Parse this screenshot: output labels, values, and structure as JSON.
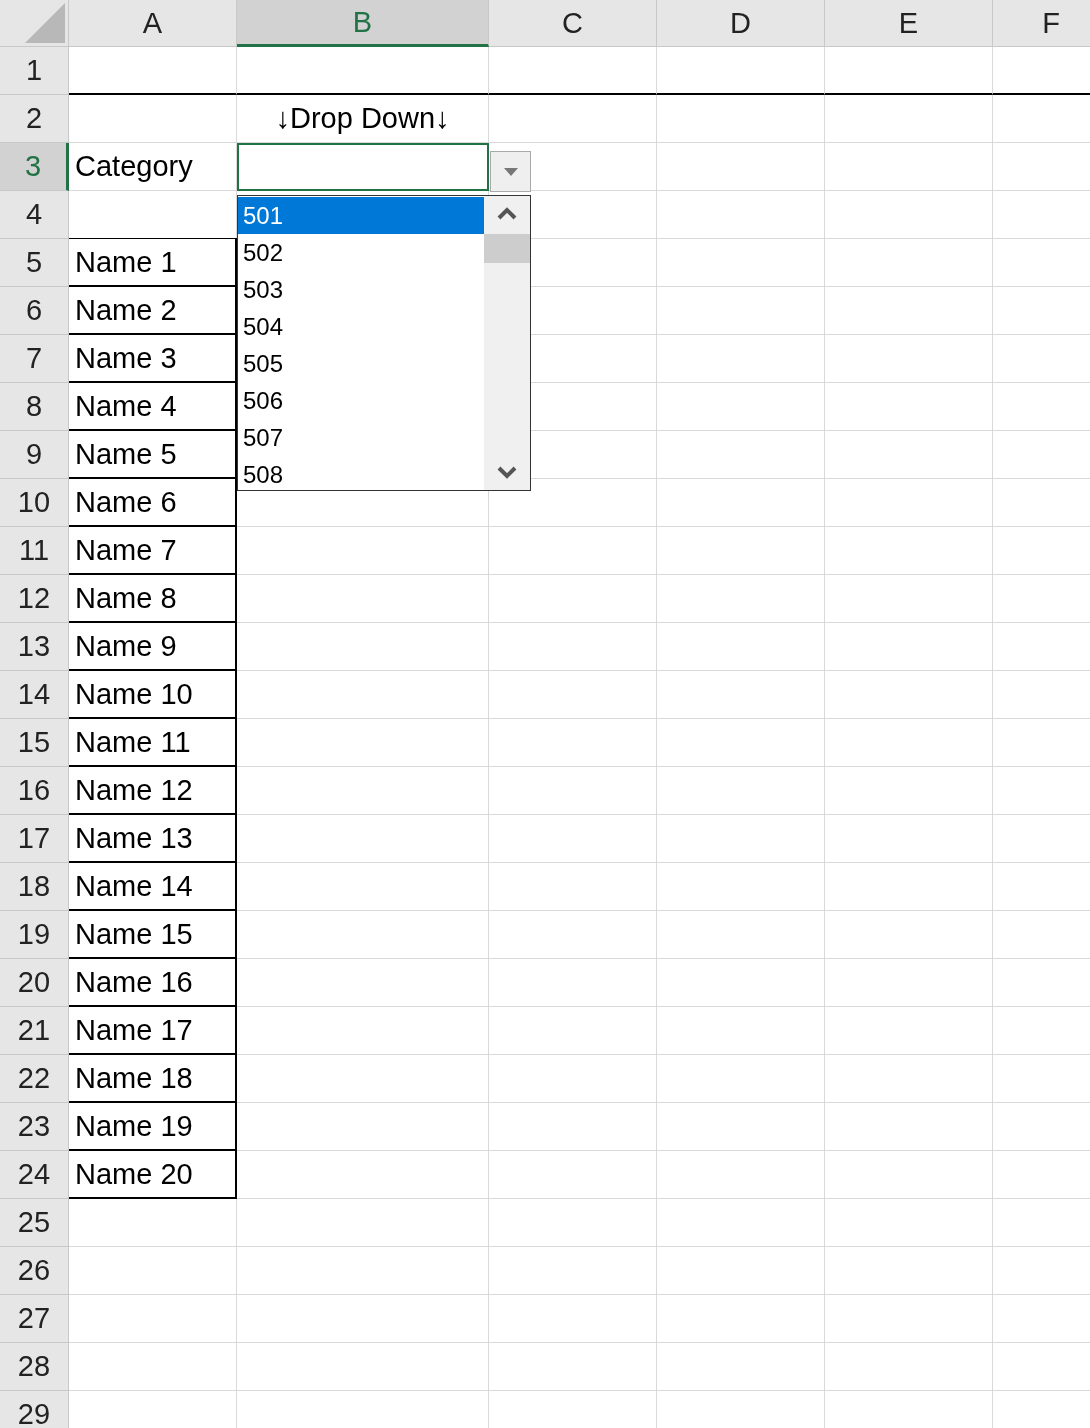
{
  "columns": [
    {
      "label": "A",
      "selected": false
    },
    {
      "label": "B",
      "selected": true
    },
    {
      "label": "C",
      "selected": false
    },
    {
      "label": "D",
      "selected": false
    },
    {
      "label": "E",
      "selected": false
    },
    {
      "label": "F",
      "selected": false
    }
  ],
  "rows": [
    {
      "header": "1",
      "selected": false,
      "rule_below": true
    },
    {
      "header": "2",
      "selected": false,
      "b": "↓Drop Down↓"
    },
    {
      "header": "3",
      "selected": true,
      "a": "Category"
    },
    {
      "header": "4",
      "selected": false
    },
    {
      "header": "5",
      "selected": false,
      "a": "Name 1",
      "boxed": true
    },
    {
      "header": "6",
      "selected": false,
      "a": "Name 2",
      "boxed": true
    },
    {
      "header": "7",
      "selected": false,
      "a": "Name 3",
      "boxed": true
    },
    {
      "header": "8",
      "selected": false,
      "a": "Name 4",
      "boxed": true
    },
    {
      "header": "9",
      "selected": false,
      "a": "Name 5",
      "boxed": true
    },
    {
      "header": "10",
      "selected": false,
      "a": "Name 6",
      "boxed": true
    },
    {
      "header": "11",
      "selected": false,
      "a": "Name 7",
      "boxed": true
    },
    {
      "header": "12",
      "selected": false,
      "a": "Name 8",
      "boxed": true
    },
    {
      "header": "13",
      "selected": false,
      "a": "Name 9",
      "boxed": true
    },
    {
      "header": "14",
      "selected": false,
      "a": "Name 10",
      "boxed": true
    },
    {
      "header": "15",
      "selected": false,
      "a": "Name 11",
      "boxed": true
    },
    {
      "header": "16",
      "selected": false,
      "a": "Name 12",
      "boxed": true
    },
    {
      "header": "17",
      "selected": false,
      "a": "Name 13",
      "boxed": true
    },
    {
      "header": "18",
      "selected": false,
      "a": "Name 14",
      "boxed": true
    },
    {
      "header": "19",
      "selected": false,
      "a": "Name 15",
      "boxed": true
    },
    {
      "header": "20",
      "selected": false,
      "a": "Name 16",
      "boxed": true
    },
    {
      "header": "21",
      "selected": false,
      "a": "Name 17",
      "boxed": true
    },
    {
      "header": "22",
      "selected": false,
      "a": "Name 18",
      "boxed": true
    },
    {
      "header": "23",
      "selected": false,
      "a": "Name 19",
      "boxed": true
    },
    {
      "header": "24",
      "selected": false,
      "a": "Name 20",
      "boxed": true
    },
    {
      "header": "25",
      "selected": false
    },
    {
      "header": "26",
      "selected": false
    },
    {
      "header": "27",
      "selected": false
    },
    {
      "header": "28",
      "selected": false
    },
    {
      "header": "29",
      "selected": false
    }
  ],
  "dropdown": {
    "options": [
      {
        "label": "501",
        "selected": true
      },
      {
        "label": "502",
        "selected": false
      },
      {
        "label": "503",
        "selected": false
      },
      {
        "label": "504",
        "selected": false
      },
      {
        "label": "505",
        "selected": false
      },
      {
        "label": "506",
        "selected": false
      },
      {
        "label": "507",
        "selected": false
      },
      {
        "label": "508",
        "selected": false
      }
    ]
  }
}
